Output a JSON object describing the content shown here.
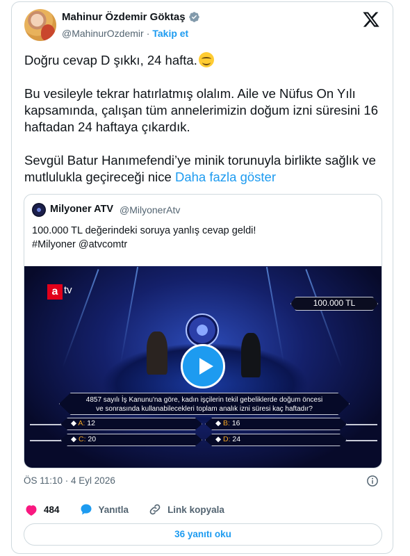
{
  "author": {
    "name": "Mahinur Özdemir Göktaş",
    "handle": "@MahinurOzdemir",
    "separator": "·",
    "follow_label": "Takip et"
  },
  "icons": {
    "verified": "verified-badge-icon",
    "platform": "x-logo-icon",
    "info": "info-icon",
    "like": "heart-icon",
    "reply": "reply-bubble-icon",
    "copy_link": "link-icon"
  },
  "tweet": {
    "line1": "Doğru cevap D şıkkı, 24 hafta.",
    "line2": "Bu vesileyle tekrar hatırlatmış olalım. Aile ve Nüfus On Yılı kapsamında, çalışan tüm annelerimizin doğum izni süresini 16 haftadan 24 haftaya çıkardık.",
    "line3": "Sevgül Batur Hanımefendi’ye minik torunuyla birlikte sağlık ve mutlulukla geçireceği nice",
    "show_more": "Daha fazla göster"
  },
  "quote": {
    "name": "Milyoner ATV",
    "handle": "@MilyonerAtv",
    "text1": "100.000 TL değerindeki soruya yanlış cevap geldi!",
    "text2": "#Milyoner @atvcomtr",
    "video": {
      "channel_a": "a",
      "channel_tv": "tv",
      "prize": "100.000 TL",
      "question1": "4857 sayılı İş Kanunu'na göre, kadın işçilerin tekil gebeliklerde doğum öncesi",
      "question2": "ve sonrasında kullanabilecekleri toplam analık izni süresi kaç haftadır?",
      "answers": [
        {
          "letter": "A:",
          "value": "12"
        },
        {
          "letter": "B:",
          "value": "16"
        },
        {
          "letter": "C:",
          "value": "20"
        },
        {
          "letter": "D:",
          "value": "24"
        }
      ]
    }
  },
  "meta": {
    "timestamp": "ÖS 11:10 · 4 Eyl 2026"
  },
  "actions": {
    "likes": "484",
    "reply_label": "Yanıtla",
    "copy_link_label": "Link kopyala"
  },
  "replies_button": "36 yanıtı oku",
  "colors": {
    "accent": "#1d9bf0",
    "like": "#f91880",
    "text": "#0f1419",
    "muted": "#536471",
    "border": "#cfd9de"
  }
}
